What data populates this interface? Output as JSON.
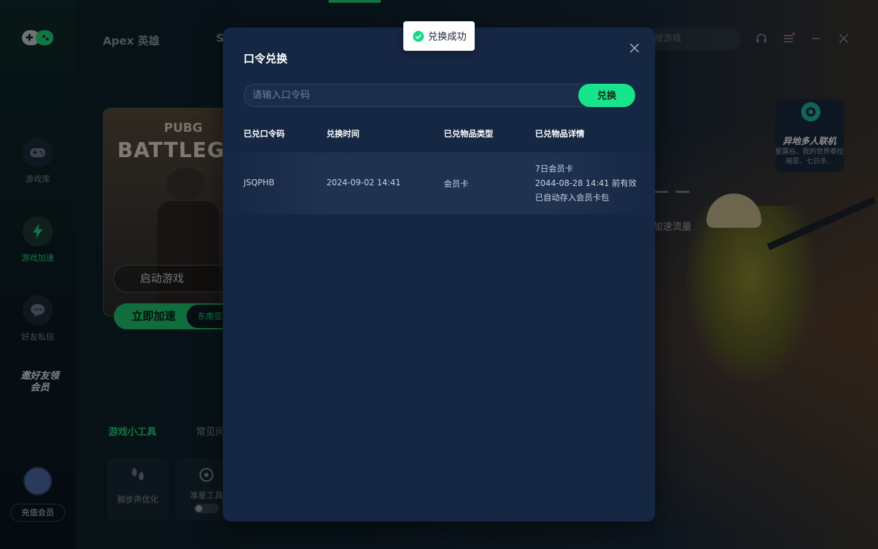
{
  "app": {
    "top_tabs": [
      "Apex 英雄",
      "S"
    ],
    "search_placeholder": "搜游戏",
    "sidebar": [
      {
        "label": "游戏库",
        "icon": "gamepad-icon"
      },
      {
        "label": "游戏加速",
        "icon": "lightning-icon"
      },
      {
        "label": "好友私信",
        "icon": "chat-bubble-icon"
      }
    ],
    "invite_text": "邀好友领会员",
    "recharge_label": "充值会员",
    "game_card": {
      "brand": "PUBG",
      "title": "BATTLEGROUNDS",
      "launch_label": "启动游戏",
      "boost_label": "立即加速",
      "region": "东南亚"
    },
    "tools": {
      "tabs": [
        "游戏小工具",
        "常见问"
      ],
      "items": [
        "脚步声优化",
        "准星工具"
      ]
    },
    "promo": {
      "title": "异地多人联机",
      "subtitle": "星露谷、我的世界泰拉瑞亚、七日杀..."
    },
    "flow_text": "加速流量"
  },
  "modal": {
    "title": "口令兑换",
    "input_placeholder": "请输入口令码",
    "input_value": "",
    "redeem_label": "兑换",
    "columns": [
      "已兑口令码",
      "兑换时间",
      "已兑物品类型",
      "已兑物品详情"
    ],
    "rows": [
      {
        "code": "JSQPHB",
        "time": "2024-09-02 14:41",
        "type": "会员卡",
        "detail": [
          "7日会员卡",
          "2044-08-28 14:41 前有效",
          "已自动存入会员卡包"
        ]
      }
    ]
  },
  "toast": {
    "text": "兑换成功",
    "icon": "check-circle-icon"
  },
  "colors": {
    "accent": "#17e58c",
    "modal_bg": "#162744",
    "success": "#17e58c"
  }
}
